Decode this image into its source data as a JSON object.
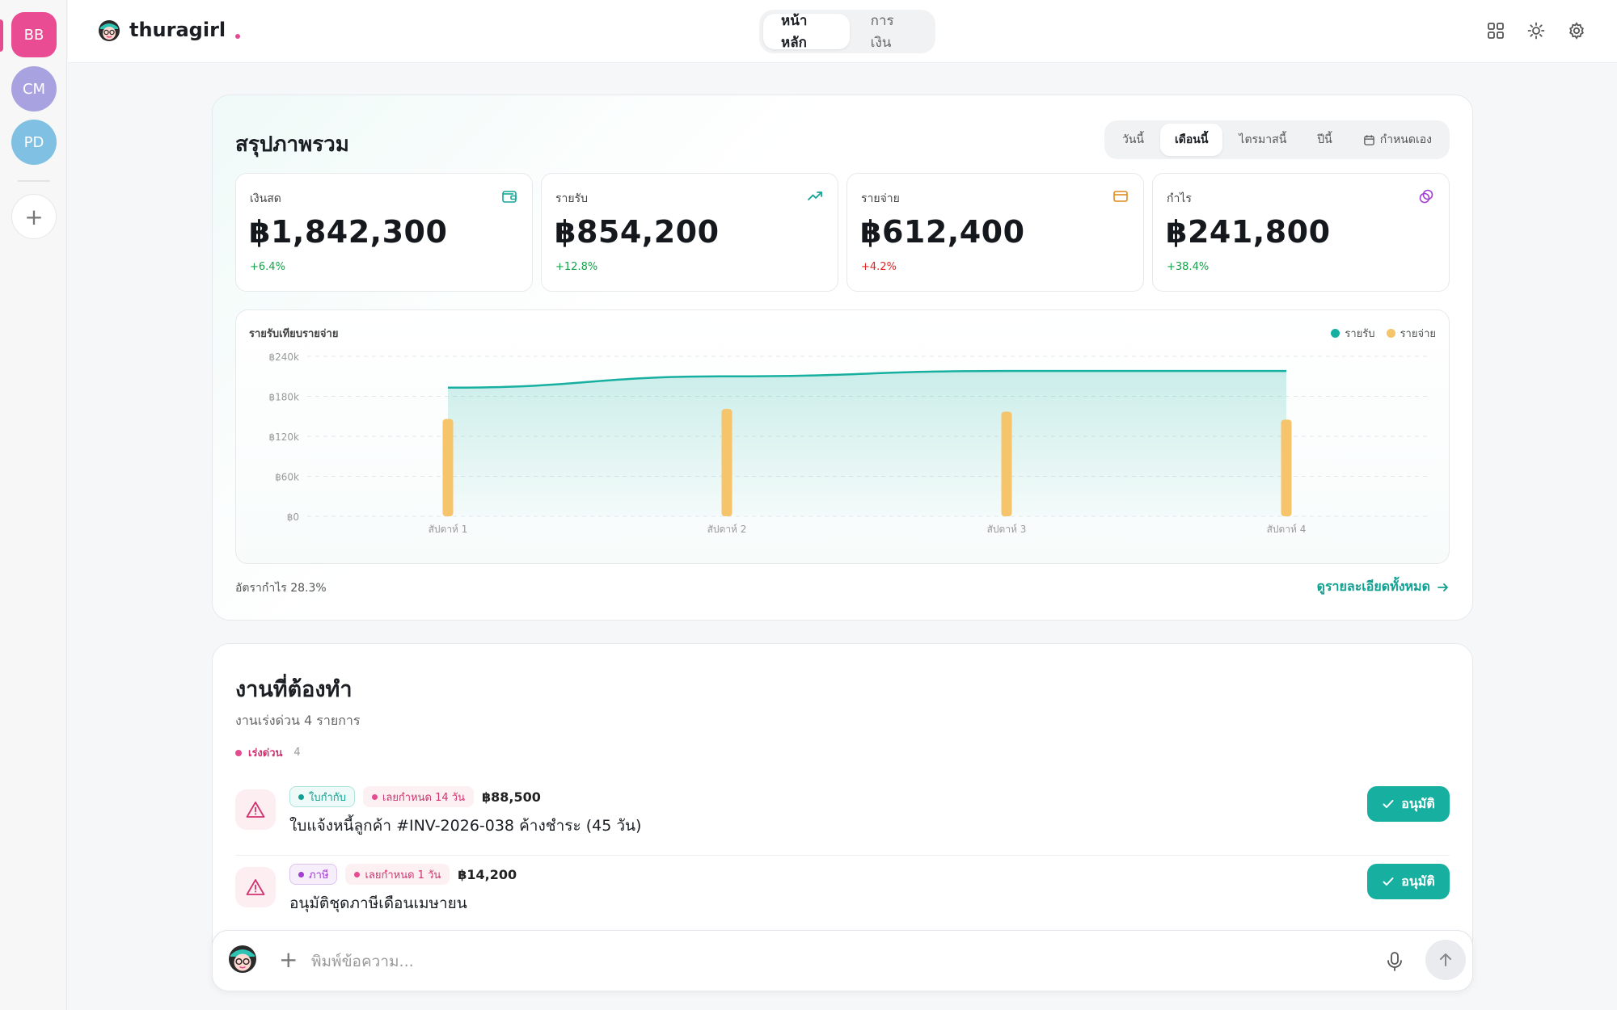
{
  "workspaces": [
    {
      "initials": "BB",
      "color": "#ea4c93",
      "active": true
    },
    {
      "initials": "CM",
      "color": "#a8a3e0",
      "active": false
    },
    {
      "initials": "PD",
      "color": "#7fc0e3",
      "active": false
    }
  ],
  "header": {
    "brand": "thuragirl",
    "nav": [
      {
        "label": "หน้าหลัก",
        "active": true
      },
      {
        "label": "การเงิน",
        "active": false
      }
    ]
  },
  "overview": {
    "title": "สรุปภาพรวม",
    "periods": [
      {
        "label": "วันนี้",
        "active": false
      },
      {
        "label": "เดือนนี้",
        "active": true
      },
      {
        "label": "ไตรมาสนี้",
        "active": false
      },
      {
        "label": "ปีนี้",
        "active": false
      },
      {
        "label": "กำหนดเอง",
        "active": false
      }
    ],
    "stats": [
      {
        "label": "เงินสด",
        "value": "฿1,842,300",
        "delta": "+6.4%",
        "delta_color": "#16a34a",
        "icon": "wallet-icon",
        "icon_color": "#14a594"
      },
      {
        "label": "รายรับ",
        "value": "฿854,200",
        "delta": "+12.8%",
        "delta_color": "#16a34a",
        "icon": "trending-up-icon",
        "icon_color": "#14a594"
      },
      {
        "label": "รายจ่าย",
        "value": "฿612,400",
        "delta": "+4.2%",
        "delta_color": "#dc2626",
        "icon": "credit-card-icon",
        "icon_color": "#e08a1e"
      },
      {
        "label": "กำไร",
        "value": "฿241,800",
        "delta": "+38.4%",
        "delta_color": "#16a34a",
        "icon": "coins-icon",
        "icon_color": "#a13fd0"
      }
    ],
    "profit_margin": "อัตรากำไร 28.3%",
    "details_link": "ดูรายละเอียดทั้งหมด"
  },
  "chart_data": {
    "type": "bar",
    "title": "รายรับเทียบรายจ่าย",
    "categories": [
      "สัปดาห์ 1",
      "สัปดาห์ 2",
      "สัปดาห์ 3",
      "สัปดาห์ 4"
    ],
    "series": [
      {
        "name": "รายรับ",
        "type": "area",
        "color": "#17b0a0",
        "values": [
          193000,
          210000,
          218000,
          218000
        ]
      },
      {
        "name": "รายจ่าย",
        "type": "bar",
        "color": "#f5c46b",
        "values": [
          146000,
          161000,
          157000,
          145000
        ]
      }
    ],
    "ylim": [
      0,
      240000
    ],
    "yticks": [
      {
        "value": 240000,
        "label": "฿240k"
      },
      {
        "value": 180000,
        "label": "฿180k"
      },
      {
        "value": 120000,
        "label": "฿120k"
      },
      {
        "value": 60000,
        "label": "฿60k"
      },
      {
        "value": 0,
        "label": "฿0"
      }
    ],
    "legend_position": "top-right",
    "grid": true
  },
  "tasks": {
    "title": "งานที่ต้องทำ",
    "subtitle": "งานเร่งด่วน 4 รายการ",
    "group": {
      "label": "เร่งด่วน",
      "count": "4"
    },
    "items": [
      {
        "type": "ใบกำกับ",
        "type_style": "teal",
        "due": "เลยกำหนด 14 วัน",
        "amount": "฿88,500",
        "title": "ใบแจ้งหนี้ลูกค้า #INV-2026-038 ค้างชำระ (45 วัน)",
        "action": "อนุมัติ"
      },
      {
        "type": "ภาษี",
        "type_style": "purple",
        "due": "เลยกำหนด 1 วัน",
        "amount": "฿14,200",
        "title": "อนุมัติชุดภาษีเดือนเมษายน",
        "action": "อนุมัติ"
      }
    ]
  },
  "composer": {
    "placeholder": "พิมพ์ข้อความ..."
  }
}
